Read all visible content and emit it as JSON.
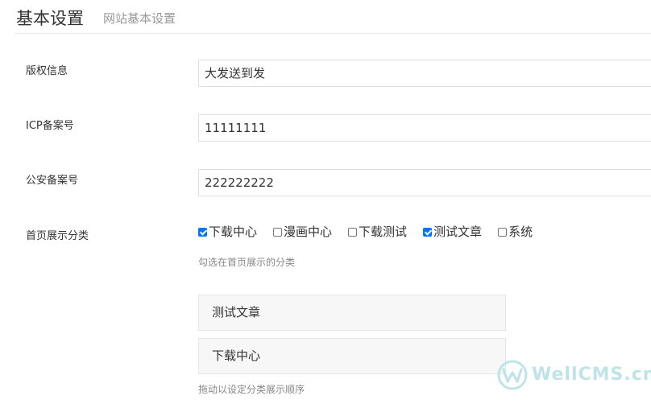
{
  "header": {
    "title": "基本设置",
    "subtitle": "网站基本设置"
  },
  "form": {
    "copyright": {
      "label": "版权信息",
      "value": "大发送到发"
    },
    "icp": {
      "label": "ICP备案号",
      "value": "11111111"
    },
    "police": {
      "label": "公安备案号",
      "value": "222222222"
    },
    "home_categories": {
      "label": "首页展示分类",
      "options": [
        {
          "label": "下载中心",
          "checked": true
        },
        {
          "label": "漫画中心",
          "checked": false
        },
        {
          "label": "下载测试",
          "checked": false
        },
        {
          "label": "测试文章",
          "checked": true
        },
        {
          "label": "系统",
          "checked": false
        }
      ],
      "hint": "勾选在首页展示的分类"
    },
    "sort": {
      "items": [
        {
          "label": "测试文章"
        },
        {
          "label": "下载中心"
        }
      ],
      "hint": "拖动以设定分类展示顺序"
    }
  },
  "watermark": {
    "text": "WellCMS.cn",
    "icon": "wellcms-logo-icon",
    "color": "#bfe4e8"
  },
  "colors": {
    "checkbox_checked": "#0075ff",
    "sort_item_bg": "#f7f7f7"
  }
}
